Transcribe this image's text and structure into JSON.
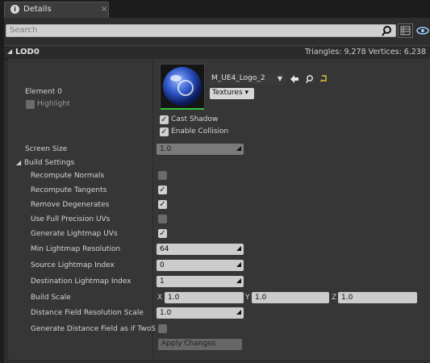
{
  "tab": {
    "title": "Details",
    "icon": "info-icon",
    "close": "×"
  },
  "search": {
    "placeholder": "Search"
  },
  "section": {
    "title": "LOD0",
    "stats": "Triangles: 9,278   Vertices: 6,238"
  },
  "element": {
    "label": "Element 0",
    "highlight_label": "Highlight",
    "highlight_checked": false,
    "material_name": "M_UE4_Logo_2",
    "textures_label": "Textures",
    "cast_shadow_label": "Cast Shadow",
    "cast_shadow_checked": true,
    "enable_collision_label": "Enable Collision",
    "enable_collision_checked": true
  },
  "screen_size": {
    "label": "Screen Size",
    "value": "1.0"
  },
  "build_settings": {
    "title": "Build Settings",
    "recompute_normals": {
      "label": "Recompute Normals",
      "checked": false
    },
    "recompute_tangents": {
      "label": "Recompute Tangents",
      "checked": true
    },
    "remove_degenerates": {
      "label": "Remove Degenerates",
      "checked": true
    },
    "full_precision_uvs": {
      "label": "Use Full Precision UVs",
      "checked": false
    },
    "generate_lightmap_uvs": {
      "label": "Generate Lightmap UVs",
      "checked": true
    },
    "min_lightmap_res": {
      "label": "Min Lightmap Resolution",
      "value": "64"
    },
    "src_lightmap_index": {
      "label": "Source Lightmap Index",
      "value": "0"
    },
    "dst_lightmap_index": {
      "label": "Destination Lightmap Index",
      "value": "1"
    },
    "build_scale": {
      "label": "Build Scale",
      "x": "1.0",
      "y": "1.0",
      "z": "1.0",
      "x_axis": "X",
      "y_axis": "Y",
      "z_axis": "Z"
    },
    "distance_field_scale": {
      "label": "Distance Field Resolution Scale",
      "value": "1.0"
    },
    "gen_distance_field_twosided": {
      "label": "Generate Distance Field as if TwoS",
      "checked": false
    }
  },
  "apply_changes_label": "Apply Changes",
  "colors": {
    "accent_green": "#35c23a",
    "panel": "#363636"
  }
}
